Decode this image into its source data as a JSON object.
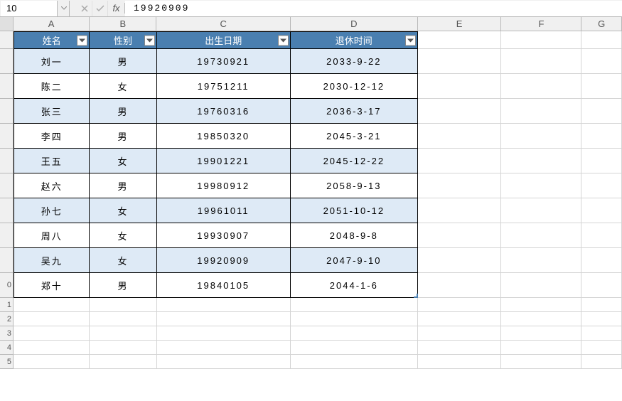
{
  "formula_bar": {
    "name_box": "10",
    "fx": "fx",
    "value": "19920909"
  },
  "columns": [
    "A",
    "B",
    "C",
    "D",
    "E",
    "F",
    "G"
  ],
  "chart_data": {
    "type": "table",
    "headers": [
      "姓名",
      "性别",
      "出生日期",
      "退休时间"
    ],
    "rows": [
      {
        "name": "刘一",
        "gender": "男",
        "dob": "19730921",
        "retire": "2033-9-22"
      },
      {
        "name": "陈二",
        "gender": "女",
        "dob": "19751211",
        "retire": "2030-12-12"
      },
      {
        "name": "张三",
        "gender": "男",
        "dob": "19760316",
        "retire": "2036-3-17"
      },
      {
        "name": "李四",
        "gender": "男",
        "dob": "19850320",
        "retire": "2045-3-21"
      },
      {
        "name": "王五",
        "gender": "女",
        "dob": "19901221",
        "retire": "2045-12-22"
      },
      {
        "name": "赵六",
        "gender": "男",
        "dob": "19980912",
        "retire": "2058-9-13"
      },
      {
        "name": "孙七",
        "gender": "女",
        "dob": "19961011",
        "retire": "2051-10-12"
      },
      {
        "name": "周八",
        "gender": "女",
        "dob": "19930907",
        "retire": "2048-9-8"
      },
      {
        "name": "吴九",
        "gender": "女",
        "dob": "19920909",
        "retire": "2047-9-10"
      },
      {
        "name": "郑十",
        "gender": "男",
        "dob": "19840105",
        "retire": "2044-1-6"
      }
    ]
  },
  "visible_row_nums": [
    "",
    "",
    "",
    "",
    "",
    "",
    "",
    "",
    "",
    "0",
    "1",
    "2",
    "3",
    "4",
    "5"
  ]
}
